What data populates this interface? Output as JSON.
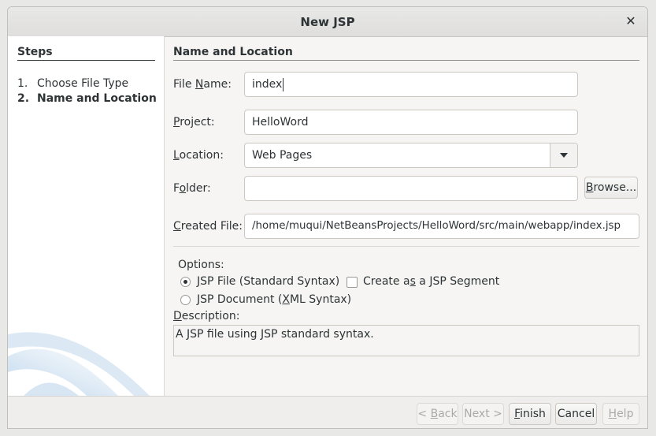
{
  "dialog": {
    "title": "New JSP"
  },
  "steps": {
    "title": "Steps",
    "items": [
      {
        "num": "1.",
        "label": "Choose File Type"
      },
      {
        "num": "2.",
        "label": "Name and Location"
      }
    ]
  },
  "section": {
    "title": "Name and Location"
  },
  "form": {
    "file_name": {
      "label_pre": "File ",
      "label_mn": "N",
      "label_post": "ame:",
      "value": "index"
    },
    "project": {
      "label_pre": "",
      "label_mn": "P",
      "label_post": "roject:",
      "value": "HelloWord"
    },
    "location": {
      "label_pre": "",
      "label_mn": "L",
      "label_post": "ocation:",
      "value": "Web Pages"
    },
    "folder": {
      "label_pre": "F",
      "label_mn": "o",
      "label_post": "lder:",
      "value": ""
    },
    "browse": {
      "label_pre": "",
      "label_mn": "B",
      "label_post": "rowse..."
    },
    "created_file": {
      "label_pre": "",
      "label_mn": "C",
      "label_post": "reated File:",
      "value": "/home/muqui/NetBeansProjects/HelloWord/src/main/webapp/index.jsp"
    }
  },
  "options": {
    "title": "Options:",
    "jsp_file": {
      "label_pre": "",
      "label_mn": "J",
      "label_post": "SP File (Standard Syntax)",
      "checked": true
    },
    "jsp_document": {
      "label_pre": "JSP Document (",
      "label_mn": "X",
      "label_post": "ML Syntax)",
      "checked": false
    },
    "segment": {
      "label_pre": "Create a",
      "label_mn": "s",
      "label_post": " a JSP Segment",
      "checked": false
    }
  },
  "description": {
    "label_pre": "",
    "label_mn": "D",
    "label_post": "escription:",
    "text": "A JSP file using JSP standard syntax."
  },
  "buttons": {
    "back": {
      "label_pre": "< ",
      "label_mn": "B",
      "label_post": "ack"
    },
    "next": {
      "label": "Next >"
    },
    "finish": {
      "label_pre": "",
      "label_mn": "F",
      "label_post": "inish"
    },
    "cancel": {
      "label": "Cancel"
    },
    "help": {
      "label_pre": "",
      "label_mn": "H",
      "label_post": "elp"
    }
  },
  "icons": {
    "close": "close-icon",
    "dropdown": "chevron-down-icon"
  }
}
